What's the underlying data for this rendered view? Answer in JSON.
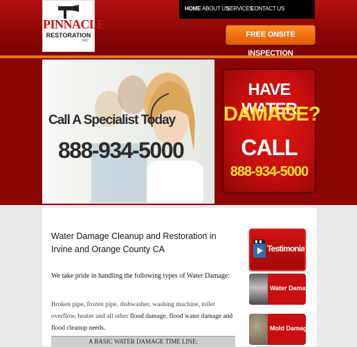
{
  "logo": {
    "brand": "PINNACLE",
    "sub": "RESTORATION",
    "inc": "INC"
  },
  "nav": {
    "items": [
      "HOME",
      "ABOUT US",
      "SERVICES",
      "CONTACT US"
    ]
  },
  "cta": {
    "label": "FREE ONSITE INSPECTION"
  },
  "hero": {
    "tagline": "Call A Specialist Today",
    "phone": "888-934-5000"
  },
  "promo": {
    "line1": "HAVE WATER",
    "line2": "DAMAGE?",
    "line3": "CALL",
    "phone": "888-934-5000"
  },
  "main": {
    "heading": "Water Damage Cleanup and Restoration in Irvine and Orange County CA",
    "intro": "We take pride in handling the following types of Water Damage:",
    "para": "Broken pipe, frozen pipe, dishwasher, washing machine, toilet overflow, heater and all other",
    "para_strong": "flood damage, flood water damage and flood cleanup needs.",
    "timeline": "A BASIC WATER DAMAGE TIME LINE:"
  },
  "sidebar": {
    "testimonials": "Testimonials",
    "water_damage": "Water Damage",
    "mold_damage": "Mold Damage"
  },
  "colors": {
    "header_red": "#a30a0a",
    "accent_orange": "#f07a1e",
    "band_red": "#8b0505",
    "promo_yellow": "#ffe227"
  }
}
